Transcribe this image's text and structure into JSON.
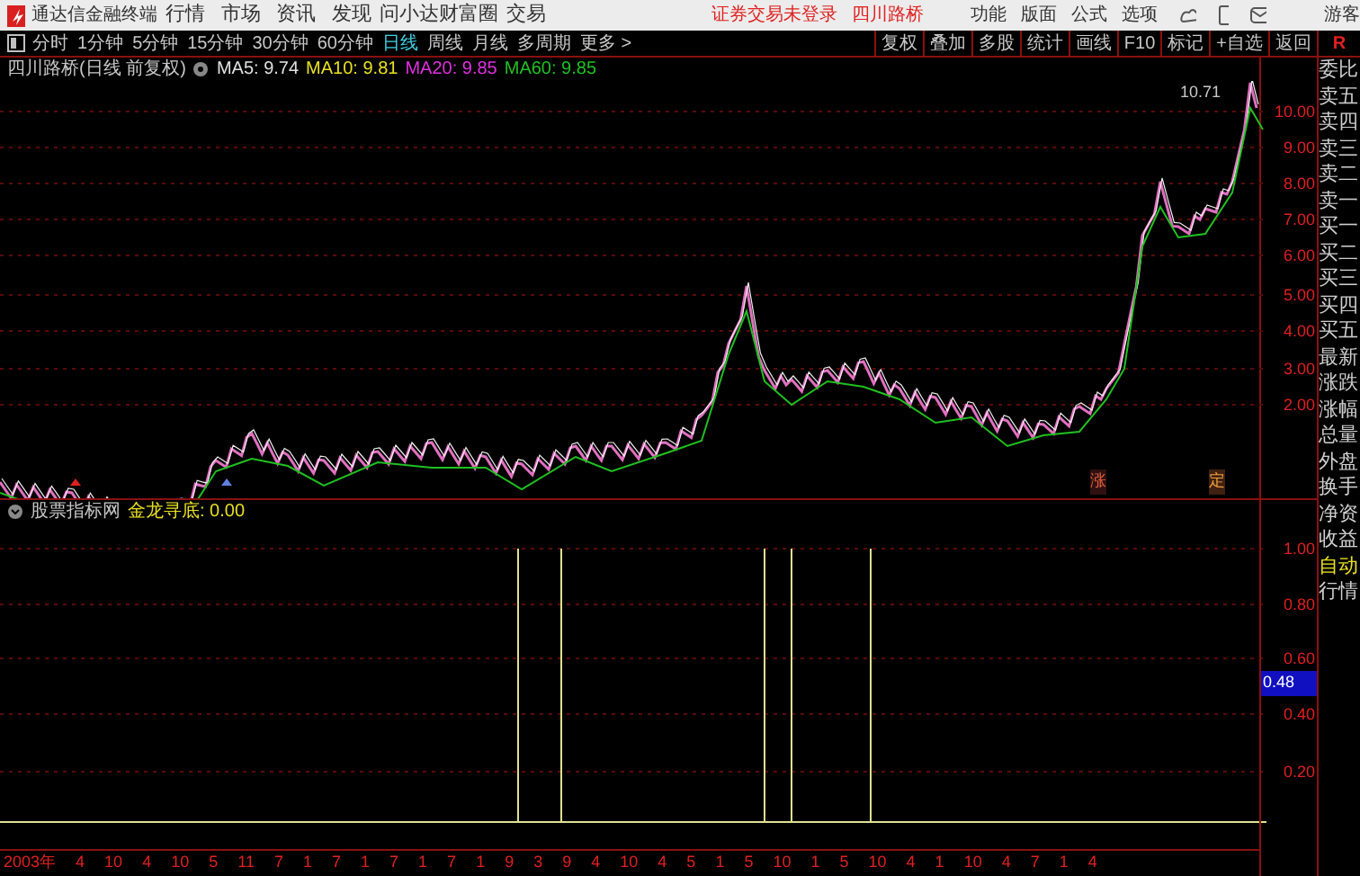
{
  "menu": {
    "app_title": "通达信金融终端",
    "items": [
      "行情",
      "市场",
      "资讯",
      "发现",
      "问小达",
      "财富圈",
      "交易"
    ],
    "login_status": "证券交易未登录",
    "stock_name": "四川路桥",
    "right_items": [
      "功能",
      "版面",
      "公式",
      "选项"
    ],
    "user": "游客"
  },
  "toolbar": {
    "periods": [
      {
        "label": "分时",
        "selected": false
      },
      {
        "label": "1分钟",
        "selected": false
      },
      {
        "label": "5分钟",
        "selected": false
      },
      {
        "label": "15分钟",
        "selected": false
      },
      {
        "label": "30分钟",
        "selected": false
      },
      {
        "label": "60分钟",
        "selected": false
      },
      {
        "label": "日线",
        "selected": true
      },
      {
        "label": "周线",
        "selected": false
      },
      {
        "label": "月线",
        "selected": false
      },
      {
        "label": "多周期",
        "selected": false
      },
      {
        "label": "更多 >",
        "selected": false
      }
    ],
    "buttons": [
      "复权",
      "叠加",
      "多股",
      "统计",
      "画线",
      "F10",
      "标记",
      "+自选",
      "返回"
    ],
    "corner": "R"
  },
  "info": {
    "title": "四川路桥(日线 前复权)",
    "ma": [
      {
        "label": "MA5: 9.74",
        "color": "#e0e0e0"
      },
      {
        "label": "MA10: 9.81",
        "color": "#e8e020"
      },
      {
        "label": "MA20: 9.85",
        "color": "#e030e0"
      },
      {
        "label": "MA60: 9.85",
        "color": "#20c020"
      }
    ]
  },
  "price_chart": {
    "high_label": "10.71",
    "axis": [
      "10.00",
      "9.00",
      "8.00",
      "7.00",
      "6.00",
      "5.00",
      "4.00",
      "3.00",
      "2.00"
    ],
    "badges": [
      "涨",
      "定"
    ]
  },
  "indicator": {
    "name": "股票指标网",
    "formula": "金龙寻底: 0.00",
    "axis": [
      "1.00",
      "0.80",
      "0.60",
      "0.40",
      "0.20"
    ],
    "current": "0.48"
  },
  "date_axis": [
    "2003年",
    "4",
    "10",
    "4",
    "10",
    "5",
    "11",
    "7",
    "1",
    "7",
    "1",
    "7",
    "1",
    "7",
    "1",
    "9",
    "3",
    "9",
    "4",
    "10",
    "4",
    "5",
    "1",
    "5",
    "10",
    "1",
    "5",
    "10",
    "4",
    "1",
    "10",
    "4",
    "7",
    "1",
    "4"
  ],
  "sidebar": [
    {
      "label": "委比",
      "kind": "quote"
    },
    {
      "label": "卖五",
      "kind": "quote"
    },
    {
      "label": "卖四",
      "kind": "quote"
    },
    {
      "label": "卖三",
      "kind": "quote"
    },
    {
      "label": "卖二",
      "kind": "quote"
    },
    {
      "label": "卖一",
      "kind": "quote"
    },
    {
      "label": "买一",
      "kind": "quote"
    },
    {
      "label": "买二",
      "kind": "quote"
    },
    {
      "label": "买三",
      "kind": "quote"
    },
    {
      "label": "买四",
      "kind": "quote"
    },
    {
      "label": "买五",
      "kind": "quote"
    },
    {
      "label": "最新",
      "kind": "quote"
    },
    {
      "label": "涨跌",
      "kind": "quote"
    },
    {
      "label": "涨幅",
      "kind": "quote"
    },
    {
      "label": "总量",
      "kind": "quote"
    },
    {
      "label": "外盘",
      "kind": "quote"
    },
    {
      "label": "换手",
      "kind": "quote"
    },
    {
      "label": "净资",
      "kind": "quote"
    },
    {
      "label": "收益",
      "kind": "quote"
    },
    {
      "label": "自动",
      "kind": "mode"
    },
    {
      "label": "行情",
      "kind": "quote"
    }
  ]
}
